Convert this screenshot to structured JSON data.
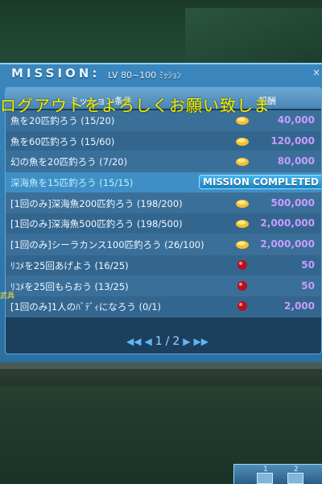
{
  "window": {
    "title": "MISSION:",
    "subtitle": "LV 80~100 ﾐｯｼｮﾝ",
    "close": "×"
  },
  "table": {
    "header_condition": "ミッション条件",
    "header_reward": "報酬",
    "rows": [
      {
        "condition": "魚を20匹釣ろう (15/20)",
        "reward": "40,000",
        "icon": "gold-coin"
      },
      {
        "condition": "魚を60匹釣ろう (15/60)",
        "reward": "120,000",
        "icon": "gold-coin"
      },
      {
        "condition": "幻の魚を20匹釣ろう (7/20)",
        "reward": "80,000",
        "icon": "gold-coin"
      },
      {
        "condition": "深海魚を15匹釣ろう (15/15)",
        "status": "MISSION COMPLETED"
      },
      {
        "condition": "[1回のみ]深海魚200匹釣ろう (198/200)",
        "reward": "500,000",
        "icon": "gold-coin"
      },
      {
        "condition": "[1回のみ]深海魚500匹釣ろう (198/500)",
        "reward": "2,000,000",
        "icon": "gold-coin"
      },
      {
        "condition": "[1回のみ]シーラカンス100匹釣ろう (26/100)",
        "reward": "2,000,000",
        "icon": "gold-coin"
      },
      {
        "condition": "ﾘｺﾒを25回あげよう (16/25)",
        "reward": "50",
        "icon": "red-gem"
      },
      {
        "condition": "ﾘｺﾒを25回もらおう (13/25)",
        "reward": "50",
        "icon": "red-gem"
      },
      {
        "condition": "[1回のみ]1人のﾊﾞﾃﾞｨになろう (0/1)",
        "reward": "2,000",
        "icon": "red-gem"
      }
    ]
  },
  "pager": {
    "first": "◀◀",
    "prev": "◀",
    "current": "1",
    "separator": "/",
    "total": "2",
    "next": "▶",
    "last": "▶▶"
  },
  "overlay_text": "ログアウトをよろしくお願い致しま",
  "side_label": "武具",
  "hotbar": {
    "slot1": "1",
    "slot2": "2"
  },
  "colors": {
    "window_bg": "#2b6fa3",
    "reward_text": "#c99cff",
    "overlay_text": "#f3f000",
    "completed_badge": "#1a86c8"
  }
}
